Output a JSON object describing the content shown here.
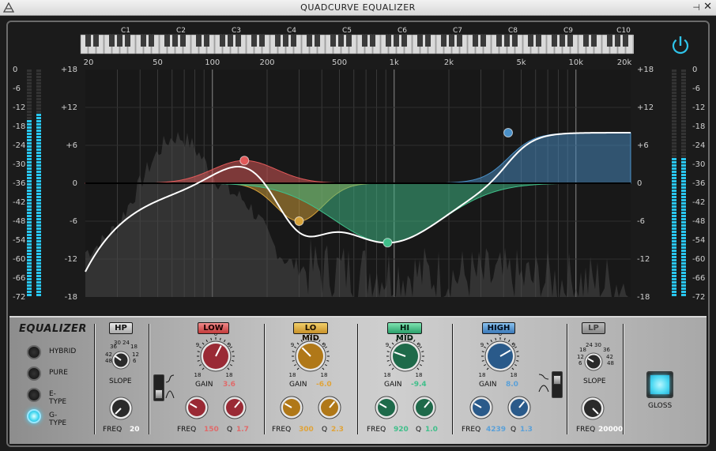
{
  "window": {
    "title": "QUADCURVE EQUALIZER",
    "pin_glyph": "⊣",
    "close_glyph": "✕"
  },
  "colors": {
    "accent": "#2fc4ea",
    "low": "#e25a5a",
    "lomid": "#d7a33a",
    "himid": "#3fbf8a",
    "high": "#4a90c8"
  },
  "display": {
    "notes": [
      "C1",
      "C2",
      "C3",
      "C4",
      "C5",
      "C6",
      "C7",
      "C8",
      "C9",
      "C10"
    ],
    "freq_labels": [
      "20",
      "50",
      "100",
      "200",
      "500",
      "1k",
      "2k",
      "5k",
      "10k",
      "20k"
    ],
    "gain_labels": [
      "+18",
      "+12",
      "+6",
      "0",
      "-6",
      "-12",
      "-18"
    ],
    "meter_labels": [
      "0",
      "-6",
      "-12",
      "-18",
      "-24",
      "-30",
      "-36",
      "-42",
      "-48",
      "-54",
      "-60",
      "-66",
      "-72"
    ],
    "meter_levels": {
      "left_in": 0.78,
      "left_in2": 0.81,
      "right_out": 0.62,
      "right_out2": 0.62
    }
  },
  "panel": {
    "title": "EQUALIZER",
    "modes": [
      {
        "label": "HYBRID",
        "active": false
      },
      {
        "label": "PURE",
        "active": false
      },
      {
        "label": "E-TYPE",
        "active": false
      },
      {
        "label": "G-TYPE",
        "active": true
      }
    ],
    "hp": {
      "button": "HP",
      "slope_label": "SLOPE",
      "freq_label": "FREQ",
      "freq_value": "20",
      "slope_scale": [
        "36",
        "30",
        "24",
        "18",
        "42",
        "12",
        "48",
        "6"
      ]
    },
    "bands": [
      {
        "id": "low",
        "button": "LOW",
        "gain_label": "GAIN",
        "gain_value": "3.6",
        "freq_label": "FREQ",
        "freq_value": "150",
        "q_label": "Q",
        "q_value": "1.7"
      },
      {
        "id": "lomid",
        "button": "LO MID",
        "gain_label": "GAIN",
        "gain_value": "-6.0",
        "freq_label": "FREQ",
        "freq_value": "300",
        "q_label": "Q",
        "q_value": "2.3"
      },
      {
        "id": "himid",
        "button": "HI MID",
        "gain_label": "GAIN",
        "gain_value": "-9.4",
        "freq_label": "FREQ",
        "freq_value": "920",
        "q_label": "Q",
        "q_value": "1.0"
      },
      {
        "id": "high",
        "button": "HIGH",
        "gain_label": "GAIN",
        "gain_value": "8.0",
        "freq_label": "FREQ",
        "freq_value": "4239",
        "q_label": "Q",
        "q_value": "1.3"
      }
    ],
    "gain_scale": [
      "0",
      "9",
      "9",
      "18",
      "18"
    ],
    "lp": {
      "button": "LP",
      "slope_label": "SLOPE",
      "freq_label": "FREQ",
      "freq_value": "20000",
      "slope_scale": [
        "18",
        "24",
        "30",
        "36",
        "12",
        "42",
        "6",
        "48"
      ]
    },
    "gloss_label": "GLOSS"
  }
}
